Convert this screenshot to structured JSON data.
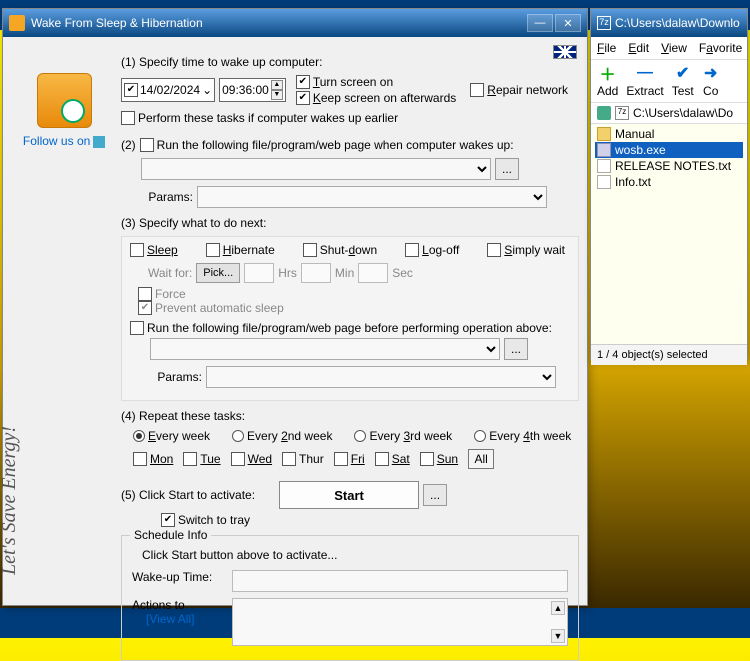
{
  "main": {
    "title": "Wake From Sleep & Hibernation",
    "follow": "Follow us on",
    "energy": "Let's Save Energy!",
    "s1": {
      "label": "(1) Specify time to wake up computer:",
      "date": "14/02/2024",
      "time": "09:36:00",
      "turn_screen": "Turn screen on",
      "keep_screen": "Keep screen on afterwards",
      "repair": "Repair network",
      "perform_earlier": "Perform these tasks if computer wakes up earlier"
    },
    "s2": {
      "label": "(2)",
      "run_label": "Run the following file/program/web page when computer wakes up:",
      "params": "Params:"
    },
    "s3": {
      "label": "(3) Specify what to do next:",
      "sleep": "Sleep",
      "hibernate": "Hibernate",
      "shutdown": "Shut-down",
      "logoff": "Log-off",
      "simply": "Simply wait",
      "wait_for": "Wait for:",
      "pick": "Pick...",
      "hrs": "Hrs",
      "min": "Min",
      "sec": "Sec",
      "force": "Force",
      "prevent": "Prevent automatic sleep",
      "run_before": "Run the following file/program/web page before performing operation above:",
      "params": "Params:"
    },
    "s4": {
      "label": "(4) Repeat these tasks:",
      "every": "Every week",
      "every2": "Every 2nd week",
      "every3": "Every 3rd week",
      "every4": "Every 4th week",
      "mon": "Mon",
      "tue": "Tue",
      "wed": "Wed",
      "thu": "Thur",
      "fri": "Fri",
      "sat": "Sat",
      "sun": "Sun",
      "all": "All"
    },
    "s5": {
      "label": "(5) Click Start to activate:",
      "start": "Start",
      "switch": "Switch to tray"
    },
    "schedule": {
      "legend": "Schedule Info",
      "hint": "Click Start button above to activate...",
      "wake": "Wake-up Time:",
      "actions": "Actions to",
      "viewall": "[View All]"
    }
  },
  "fw": {
    "title": "C:\\Users\\dalaw\\Downlo",
    "menu": {
      "file": "File",
      "edit": "Edit",
      "view": "View",
      "fav": "Favorite"
    },
    "tools": {
      "add": "Add",
      "extract": "Extract",
      "test": "Test",
      "co": "Co"
    },
    "addr": "C:\\Users\\dalaw\\Do",
    "files": [
      {
        "name": "Manual",
        "type": "folder"
      },
      {
        "name": "wosb.exe",
        "type": "exe",
        "selected": true
      },
      {
        "name": "RELEASE NOTES.txt",
        "type": "txt"
      },
      {
        "name": "Info.txt",
        "type": "txt"
      }
    ],
    "status": "1 / 4 object(s) selected"
  }
}
